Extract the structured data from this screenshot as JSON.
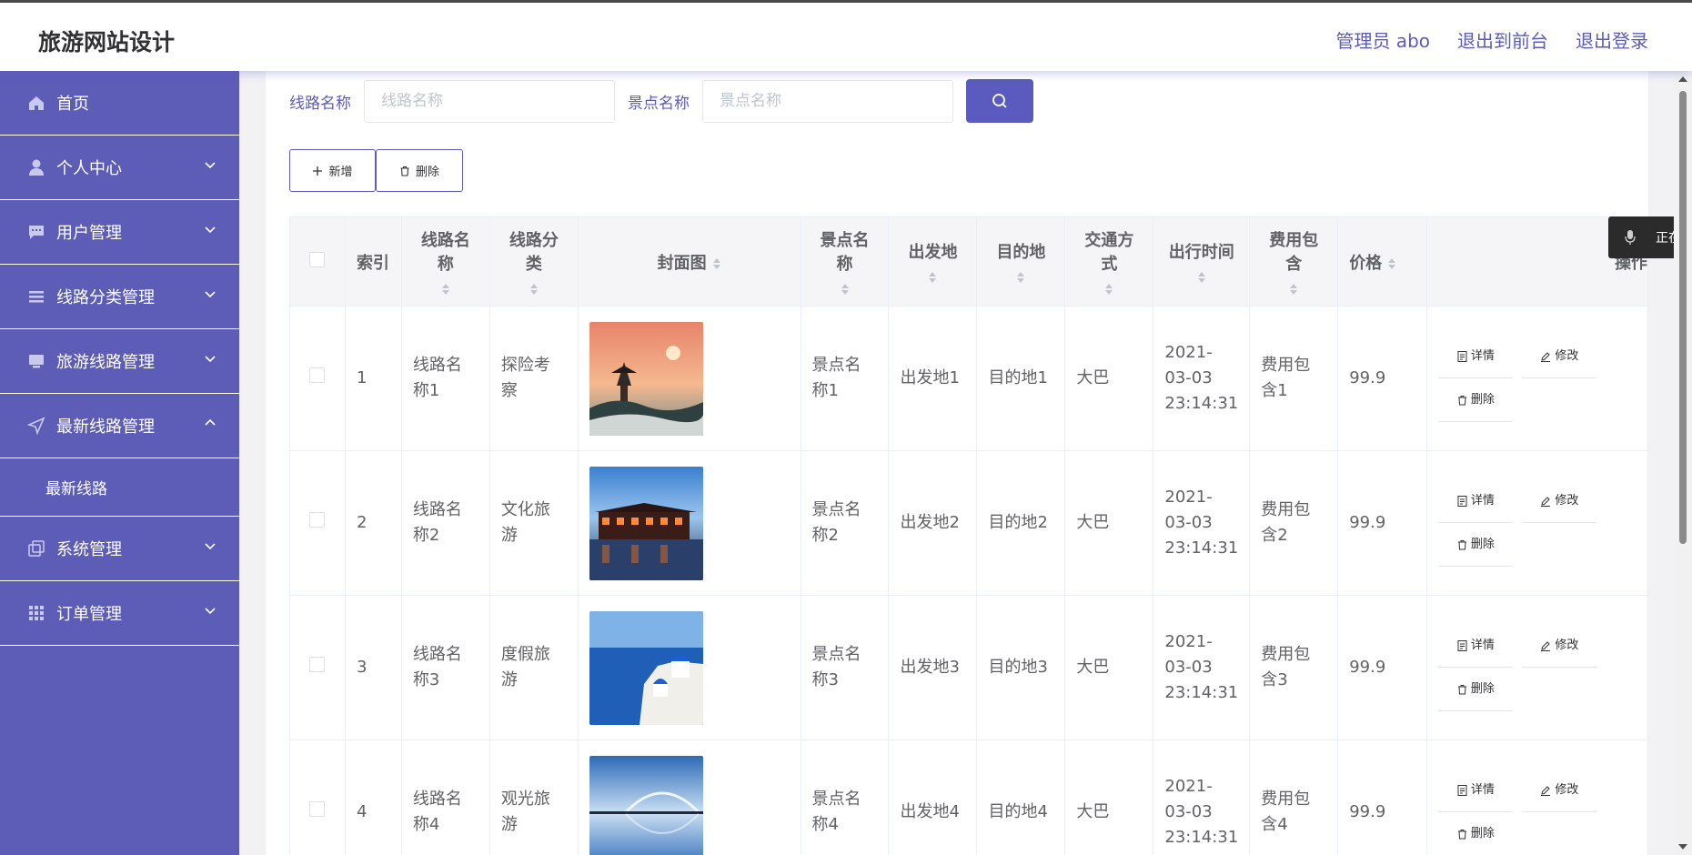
{
  "header": {
    "brand": "旅游网站设计",
    "admin_label": "管理员 abo",
    "exit_front": "退出到前台",
    "logout": "退出登录"
  },
  "sidebar": {
    "items": [
      {
        "label": "首页",
        "icon": "home-icon"
      },
      {
        "label": "个人中心",
        "icon": "user-icon"
      },
      {
        "label": "用户管理",
        "icon": "chat-icon"
      },
      {
        "label": "线路分类管理",
        "icon": "list-icon"
      },
      {
        "label": "旅游线路管理",
        "icon": "monitor-icon"
      },
      {
        "label": "最新线路管理",
        "icon": "send-icon"
      },
      {
        "label": "系统管理",
        "icon": "copy-icon"
      },
      {
        "label": "订单管理",
        "icon": "grid-icon"
      }
    ],
    "submenu": {
      "label": "最新线路"
    }
  },
  "search": {
    "route_label": "线路名称",
    "route_placeholder": "线路名称",
    "spot_label": "景点名称",
    "spot_placeholder": "景点名称"
  },
  "actions": {
    "add": "新增",
    "delete": "删除"
  },
  "table": {
    "headers": {
      "index": "索引",
      "route_name": "线路名称",
      "category": "线路分类",
      "cover": "封面图",
      "spot_name": "景点名称",
      "origin": "出发地",
      "destination": "目的地",
      "transport": "交通方式",
      "depart_time": "出行时间",
      "fee_includes": "费用包含",
      "price": "价格",
      "ops": "操作"
    },
    "ops": {
      "detail": "详情",
      "edit": "修改",
      "delete": "删除"
    },
    "rows": [
      {
        "index": "1",
        "route_name": "线路名称1",
        "category": "探险考察",
        "spot_name": "景点名称1",
        "origin": "出发地1",
        "destination": "目的地1",
        "transport": "大巴",
        "depart_time": "2021-03-03 23:14:31",
        "fee_includes": "费用包含1",
        "price": "99.9"
      },
      {
        "index": "2",
        "route_name": "线路名称2",
        "category": "文化旅游",
        "spot_name": "景点名称2",
        "origin": "出发地2",
        "destination": "目的地2",
        "transport": "大巴",
        "depart_time": "2021-03-03 23:14:31",
        "fee_includes": "费用包含2",
        "price": "99.9"
      },
      {
        "index": "3",
        "route_name": "线路名称3",
        "category": "度假旅游",
        "spot_name": "景点名称3",
        "origin": "出发地3",
        "destination": "目的地3",
        "transport": "大巴",
        "depart_time": "2021-03-03 23:14:31",
        "fee_includes": "费用包含3",
        "price": "99.9"
      },
      {
        "index": "4",
        "route_name": "线路名称4",
        "category": "观光旅游",
        "spot_name": "景点名称4",
        "origin": "出发地4",
        "destination": "目的地4",
        "transport": "大巴",
        "depart_time": "2021-03-03 23:14:31",
        "fee_includes": "费用包含4",
        "price": "99.9"
      }
    ]
  },
  "voice_overlay": {
    "text": "正在"
  },
  "colors": {
    "accent": "#5b5bbf",
    "sidebar": "#5d5db8"
  }
}
